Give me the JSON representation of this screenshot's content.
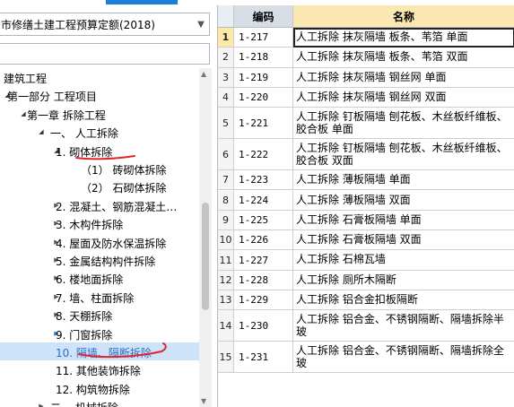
{
  "quota": {
    "selected": "市修缮土建工程预算定额(2018)"
  },
  "tree": [
    {
      "label": "建筑工程",
      "level": 0,
      "toggle": ""
    },
    {
      "label": "第一部分  工程项目",
      "level": 1,
      "toggle": "expanded"
    },
    {
      "label": "第一章  拆除工程",
      "level": 2,
      "toggle": "expanded"
    },
    {
      "label": "一、  人工拆除",
      "level": 3,
      "toggle": "expanded"
    },
    {
      "label": "1.  砌体拆除",
      "level": 4,
      "toggle": "expanded"
    },
    {
      "label": "（1） 砖砌体拆除",
      "level": 5,
      "toggle": ""
    },
    {
      "label": "（2） 石砌体拆除",
      "level": 5,
      "toggle": ""
    },
    {
      "label": "2.  混凝土、钢筋混凝土…",
      "level": 4,
      "toggle": "collapsed"
    },
    {
      "label": "3.  木构件拆除",
      "level": 4,
      "toggle": "collapsed"
    },
    {
      "label": "4.  屋面及防水保温拆除",
      "level": 4,
      "toggle": "collapsed"
    },
    {
      "label": "5.  金属结构构件拆除",
      "level": 4,
      "toggle": "collapsed"
    },
    {
      "label": "6.  楼地面拆除",
      "level": 4,
      "toggle": "collapsed"
    },
    {
      "label": "7.  墙、柱面拆除",
      "level": 4,
      "toggle": "collapsed"
    },
    {
      "label": "8.  天棚拆除",
      "level": 4,
      "toggle": "collapsed"
    },
    {
      "label": "9.  门窗拆除",
      "level": 4,
      "toggle": "collapsed-blue"
    },
    {
      "label": "10.  隔墙、隔断拆除",
      "level": 4,
      "toggle": "",
      "selected": true
    },
    {
      "label": "11.  其他装饰拆除",
      "level": 4,
      "toggle": ""
    },
    {
      "label": "12.  构筑物拆除",
      "level": 4,
      "toggle": ""
    },
    {
      "label": "二、  机械拆除",
      "level": 3,
      "toggle": "collapsed"
    }
  ],
  "grid": {
    "headers": {
      "code": "编码",
      "name": "名称"
    },
    "rows": [
      {
        "num": "1",
        "code": "1-217",
        "name": "人工拆除 抹灰隔墙 板条、苇箔 单面",
        "active": true
      },
      {
        "num": "2",
        "code": "1-218",
        "name": "人工拆除 抹灰隔墙 板条、苇箔 双面"
      },
      {
        "num": "3",
        "code": "1-219",
        "name": "人工拆除 抹灰隔墙 钢丝网 单面"
      },
      {
        "num": "4",
        "code": "1-220",
        "name": "人工拆除 抹灰隔墙 钢丝网 双面"
      },
      {
        "num": "5",
        "code": "1-221",
        "name": "人工拆除 钉板隔墙 刨花板、木丝板纤维板、胶合板 单面"
      },
      {
        "num": "6",
        "code": "1-222",
        "name": "人工拆除 钉板隔墙 刨花板、木丝板纤维板、胶合板 双面"
      },
      {
        "num": "7",
        "code": "1-223",
        "name": "人工拆除 薄板隔墙 单面"
      },
      {
        "num": "8",
        "code": "1-224",
        "name": "人工拆除 薄板隔墙 双面"
      },
      {
        "num": "9",
        "code": "1-225",
        "name": "人工拆除 石膏板隔墙 单面"
      },
      {
        "num": "10",
        "code": "1-226",
        "name": "人工拆除 石膏板隔墙 双面"
      },
      {
        "num": "11",
        "code": "1-227",
        "name": "人工拆除 石棉瓦墙"
      },
      {
        "num": "12",
        "code": "1-228",
        "name": "人工拆除 厕所木隔断"
      },
      {
        "num": "13",
        "code": "1-229",
        "name": "人工拆除 铝合金扣板隔断"
      },
      {
        "num": "14",
        "code": "1-230",
        "name": "人工拆除 铝合金、不锈钢隔断、隔墙拆除半玻"
      },
      {
        "num": "15",
        "code": "1-231",
        "name": "人工拆除 铝合金、不锈钢隔断、隔墙拆除全玻"
      }
    ]
  },
  "icons": {
    "dropdown": "chevron-down-icon",
    "expanded": "triangle-down-icon",
    "collapsed": "triangle-right-icon"
  },
  "colors": {
    "accent": "#1e7fd8",
    "selected_row": "#cde3f9",
    "name_header": "#fbe7b2",
    "pen_annotation": "#e0242a"
  }
}
